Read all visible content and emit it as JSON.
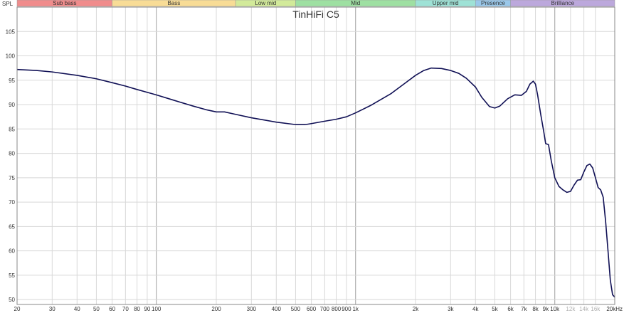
{
  "chart_data": {
    "type": "line",
    "title": "TinHiFi C5",
    "ylabel": "SPL",
    "xunit": "Hz",
    "xscale": "log",
    "xlim": [
      20,
      20000
    ],
    "ylim": [
      49,
      110
    ],
    "grid": true,
    "colors": {
      "line": "#101055",
      "grid": "#d8d8d8",
      "grid_major": "#a8a8a8"
    },
    "y_ticks": [
      50,
      55,
      60,
      65,
      70,
      75,
      80,
      85,
      90,
      95,
      100,
      105
    ],
    "x_ticks": [
      {
        "value": 20,
        "label": "20"
      },
      {
        "value": 30,
        "label": "30"
      },
      {
        "value": 40,
        "label": "40"
      },
      {
        "value": 50,
        "label": "50"
      },
      {
        "value": 60,
        "label": "60"
      },
      {
        "value": 70,
        "label": "70"
      },
      {
        "value": 80,
        "label": "80"
      },
      {
        "value": 90,
        "label": "90"
      },
      {
        "value": 100,
        "label": "100"
      },
      {
        "value": 200,
        "label": "200"
      },
      {
        "value": 300,
        "label": "300"
      },
      {
        "value": 400,
        "label": "400"
      },
      {
        "value": 500,
        "label": "500"
      },
      {
        "value": 600,
        "label": "600"
      },
      {
        "value": 700,
        "label": "700"
      },
      {
        "value": 800,
        "label": "800"
      },
      {
        "value": 900,
        "label": "900"
      },
      {
        "value": 1000,
        "label": "1k"
      },
      {
        "value": 2000,
        "label": "2k"
      },
      {
        "value": 3000,
        "label": "3k"
      },
      {
        "value": 4000,
        "label": "4k"
      },
      {
        "value": 5000,
        "label": "5k"
      },
      {
        "value": 6000,
        "label": "6k"
      },
      {
        "value": 7000,
        "label": "7k"
      },
      {
        "value": 8000,
        "label": "8k"
      },
      {
        "value": 9000,
        "label": "9k"
      },
      {
        "value": 10000,
        "label": "10k"
      },
      {
        "value": 12000,
        "label": "12k",
        "muted": true
      },
      {
        "value": 14000,
        "label": "14k",
        "muted": true
      },
      {
        "value": 16000,
        "label": "16k",
        "muted": true
      },
      {
        "value": 20000,
        "label": "20kHz"
      }
    ],
    "bands": [
      {
        "name": "Sub bass",
        "from": 20,
        "to": 60,
        "color": "#f08c8c"
      },
      {
        "name": "Bass",
        "from": 60,
        "to": 250,
        "color": "#f8dc96"
      },
      {
        "name": "Low mid",
        "from": 250,
        "to": 500,
        "color": "#d2ea9a"
      },
      {
        "name": "Mid",
        "from": 500,
        "to": 2000,
        "color": "#9ee0a2"
      },
      {
        "name": "Upper mid",
        "from": 2000,
        "to": 4000,
        "color": "#9ee2d6"
      },
      {
        "name": "Presence",
        "from": 4000,
        "to": 6000,
        "color": "#9ac8ea"
      },
      {
        "name": "Brilliance",
        "from": 6000,
        "to": 20000,
        "color": "#bca8dc"
      }
    ],
    "series": [
      {
        "x": [
          20,
          25,
          30,
          40,
          50,
          60,
          70,
          80,
          100,
          120,
          150,
          180,
          200,
          220,
          250,
          300,
          400,
          500,
          560,
          600,
          700,
          800,
          900,
          1000,
          1200,
          1500,
          1800,
          2000,
          2200,
          2400,
          2700,
          3000,
          3300,
          3600,
          4000,
          4300,
          4700,
          5000,
          5300,
          5800,
          6300,
          6800,
          7200,
          7500,
          7800,
          8000,
          8200,
          8500,
          8800,
          9000,
          9300,
          9600,
          10000,
          10500,
          11000,
          11500,
          12000,
          12500,
          13000,
          13500,
          14000,
          14500,
          15000,
          15500,
          16000,
          16500,
          17000,
          17500,
          18000,
          18500,
          19000,
          19500,
          20000
        ],
        "y": [
          97.2,
          97.0,
          96.7,
          96.0,
          95.3,
          94.5,
          93.8,
          93.1,
          92.0,
          91.0,
          89.8,
          88.9,
          88.5,
          88.5,
          88.0,
          87.3,
          86.4,
          85.9,
          85.9,
          86.1,
          86.6,
          87.0,
          87.5,
          88.3,
          89.9,
          92.2,
          94.6,
          96.0,
          97.0,
          97.5,
          97.4,
          97.0,
          96.4,
          95.4,
          93.6,
          91.5,
          89.6,
          89.3,
          89.7,
          91.2,
          92.0,
          91.9,
          92.7,
          94.2,
          94.8,
          94.2,
          92.0,
          88.0,
          84.5,
          82.0,
          81.8,
          78.5,
          75.0,
          73.2,
          72.5,
          72.0,
          72.2,
          73.5,
          74.5,
          74.6,
          76.2,
          77.5,
          77.8,
          77.0,
          75.0,
          73.0,
          72.5,
          71.0,
          66.0,
          60.0,
          54.0,
          51.0,
          50.5
        ]
      }
    ]
  }
}
